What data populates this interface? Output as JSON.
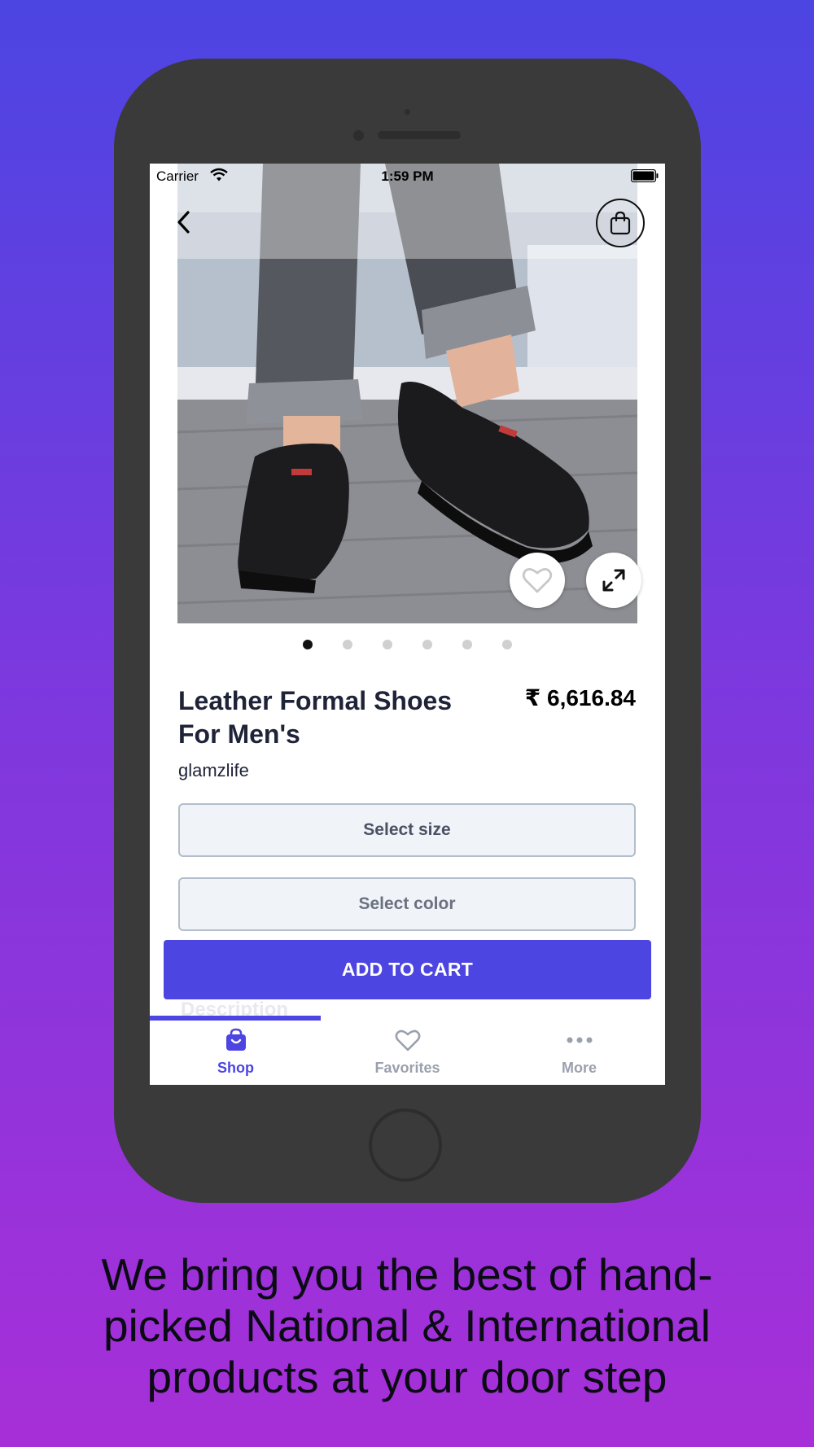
{
  "status_bar": {
    "carrier": "Carrier",
    "time": "1:59 PM"
  },
  "product": {
    "title": "Leather Formal Shoes For Men's",
    "price": "₹ 6,616.84",
    "brand": "glamzlife",
    "image_count": 6,
    "active_image_index": 0
  },
  "actions": {
    "select_size": "Select size",
    "select_color": "Select color",
    "add_to_cart": "ADD TO CART",
    "description_peek": "Description"
  },
  "tabs": [
    {
      "label": "Shop",
      "icon": "shopping-bag-icon",
      "active": true
    },
    {
      "label": "Favorites",
      "icon": "heart-icon",
      "active": false
    },
    {
      "label": "More",
      "icon": "more-dots-icon",
      "active": false
    }
  ],
  "caption": "We bring you the best of hand-picked National & International products at your door step",
  "colors": {
    "accent": "#4c45e2",
    "inactive_tab": "#9aa0ad",
    "text_dark": "#1e2338",
    "phone_frame": "#3a3a3a"
  }
}
